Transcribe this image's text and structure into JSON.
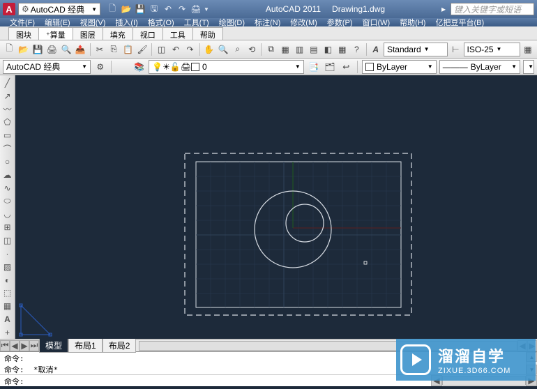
{
  "titlebar": {
    "workspace": "AutoCAD 经典",
    "app_name": "AutoCAD 2011",
    "file_name": "Drawing1.dwg",
    "search_placeholder": "键入关键字或短语"
  },
  "menubar": [
    "文件(F)",
    "编辑(E)",
    "视图(V)",
    "插入(I)",
    "格式(O)",
    "工具(T)",
    "绘图(D)",
    "标注(N)",
    "修改(M)",
    "参数(P)",
    "窗口(W)",
    "帮助(H)",
    "亿把豆平台(B)"
  ],
  "tabs": [
    "图块",
    "算量",
    "图层",
    "填充",
    "视口",
    "工具",
    "帮助"
  ],
  "tabs_active": 1,
  "style_select": "Standard",
  "dim_select": "ISO-25",
  "workspace2": "AutoCAD 经典",
  "layer_current": "0",
  "color_select": "ByLayer",
  "linetype_select": "ByLayer",
  "layout_tabs": [
    "模型",
    "布局1",
    "布局2"
  ],
  "layout_active": 0,
  "cmd_history": [
    "命令:",
    "命令:  *取消*"
  ],
  "cmd_prompt": "命令:",
  "watermark": {
    "title": "溜溜自学",
    "url": "ZIXUE.3D66.COM"
  }
}
